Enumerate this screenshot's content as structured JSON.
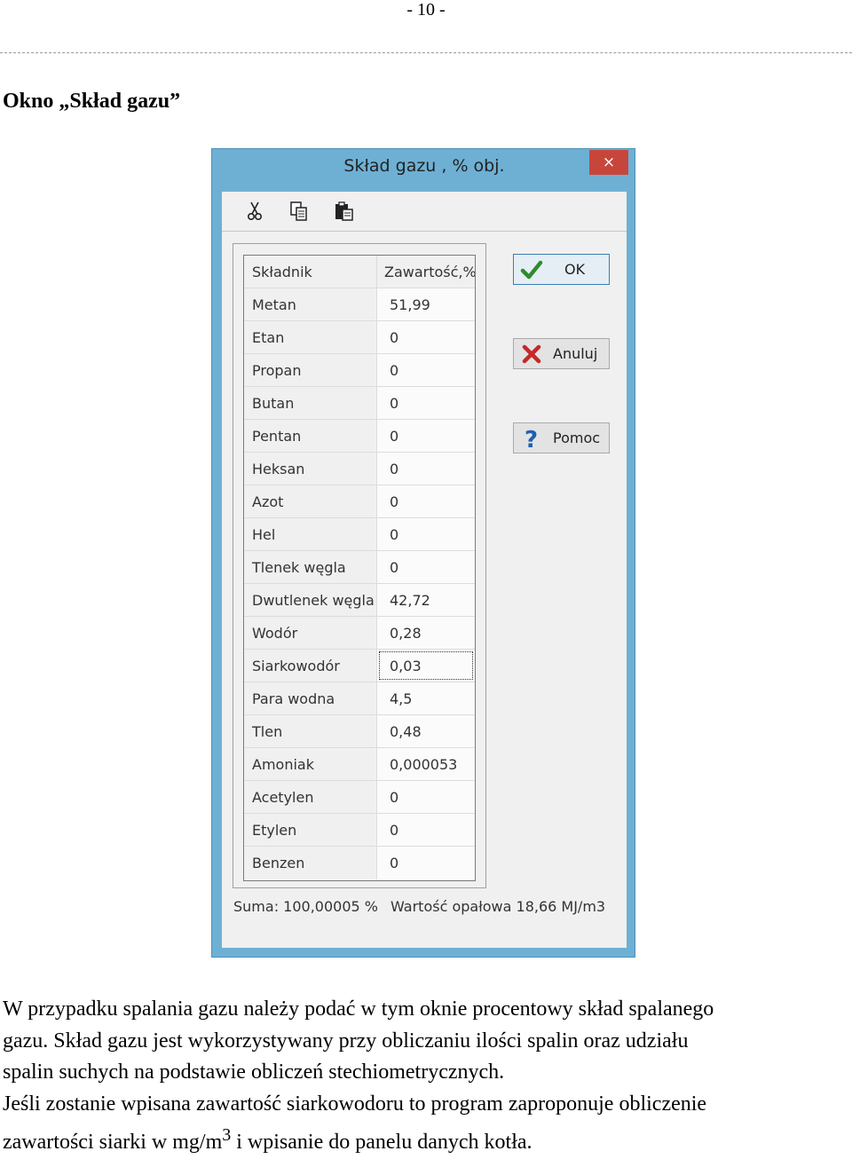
{
  "page": {
    "header": "- 10 -",
    "section_title": "Okno „Skład gazu”"
  },
  "dialog": {
    "title": "Skład gazu , % obj.",
    "close_label": "×",
    "toolbar": [
      "scissors-icon",
      "copy-icon",
      "paste-icon"
    ],
    "grid": {
      "headers": [
        "Składnik",
        "Zawartość,%"
      ],
      "rows": [
        [
          "Metan",
          "51,99"
        ],
        [
          "Etan",
          "0"
        ],
        [
          "Propan",
          "0"
        ],
        [
          "Butan",
          "0"
        ],
        [
          "Pentan",
          "0"
        ],
        [
          "Heksan",
          "0"
        ],
        [
          "Azot",
          "0"
        ],
        [
          "Hel",
          "0"
        ],
        [
          "Tlenek węgla",
          "0"
        ],
        [
          "Dwutlenek węgla",
          "42,72"
        ],
        [
          "Wodór",
          "0,28"
        ],
        [
          "Siarkowodór",
          "0,03"
        ],
        [
          "Para wodna",
          "4,5"
        ],
        [
          "Tlen",
          "0,48"
        ],
        [
          "Amoniak",
          "0,000053"
        ],
        [
          "Acetylen",
          "0"
        ],
        [
          "Etylen",
          "0"
        ],
        [
          "Benzen",
          "0"
        ]
      ]
    },
    "buttons": {
      "ok": "OK",
      "cancel": "Anuluj",
      "help": "Pomoc"
    },
    "status": {
      "sum": "Suma: 100,00005 %",
      "calorific": "Wartość opałowa 18,66 MJ/m3"
    },
    "colors": {
      "frame": "#6eb0d4",
      "close": "#c7463c",
      "ok_check": "#2e8b2e",
      "cancel_x": "#c62828",
      "help_q": "#1e5fb4"
    }
  },
  "body": {
    "line1": "W  przypadku spalania gazu należy podać w tym oknie procentowy skład spalanego",
    "line2": "gazu. Skład gazu jest wykorzystywany przy obliczaniu ilości spalin oraz udziału",
    "line3": "spalin suchych na podstawie obliczeń stechiometrycznych.",
    "line4": "Jeśli zostanie wpisana zawartość siarkowodoru to program  zaproponuje obliczenie",
    "line5_a": "zawartości siarki  w mg/m",
    "line5_sup": "3",
    "line5_b": " i wpisanie  do panelu danych kotła."
  }
}
